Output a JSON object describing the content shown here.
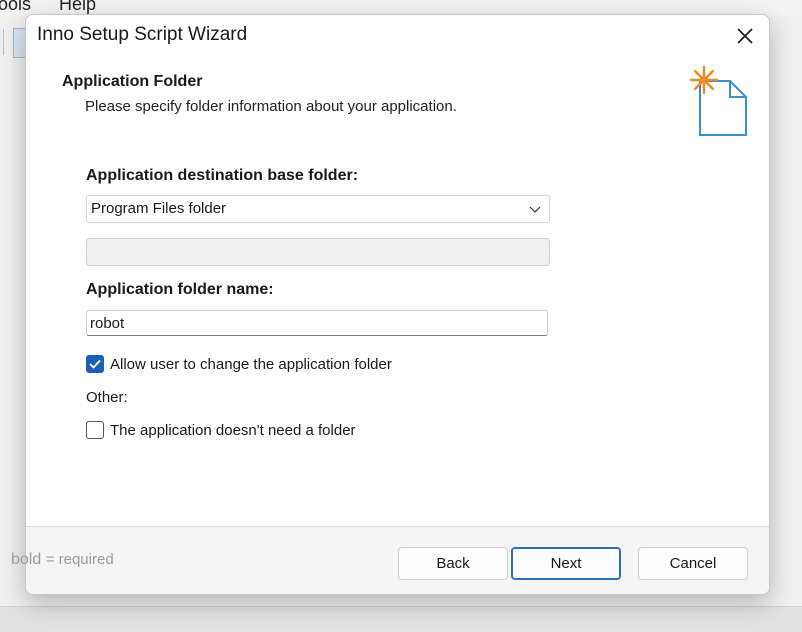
{
  "background": {
    "menu": [
      "ools",
      "Help"
    ]
  },
  "dialog": {
    "title": "Inno Setup Script Wizard",
    "header": {
      "title": "Application Folder",
      "subtitle": "Please specify folder information about your application."
    },
    "fields": {
      "base_folder_label": "Application destination base folder:",
      "base_folder_value": "Program Files folder",
      "custom_base_folder_value": "",
      "folder_name_label": "Application folder name:",
      "folder_name_value": "robot",
      "allow_change_label": "Allow user to change the application folder",
      "allow_change_checked": true,
      "other_label": "Other:",
      "no_folder_label": "The application doesn't need a folder",
      "no_folder_checked": false
    },
    "footer": {
      "hint_bold": "bold",
      "hint_rest": "= required",
      "back_label": "Back",
      "next_label": "Next",
      "cancel_label": "Cancel"
    }
  },
  "colors": {
    "accent": "#1c5fb4",
    "wizard_icon_star": "#f08a24",
    "wizard_icon_page": "#3a8fd0"
  }
}
